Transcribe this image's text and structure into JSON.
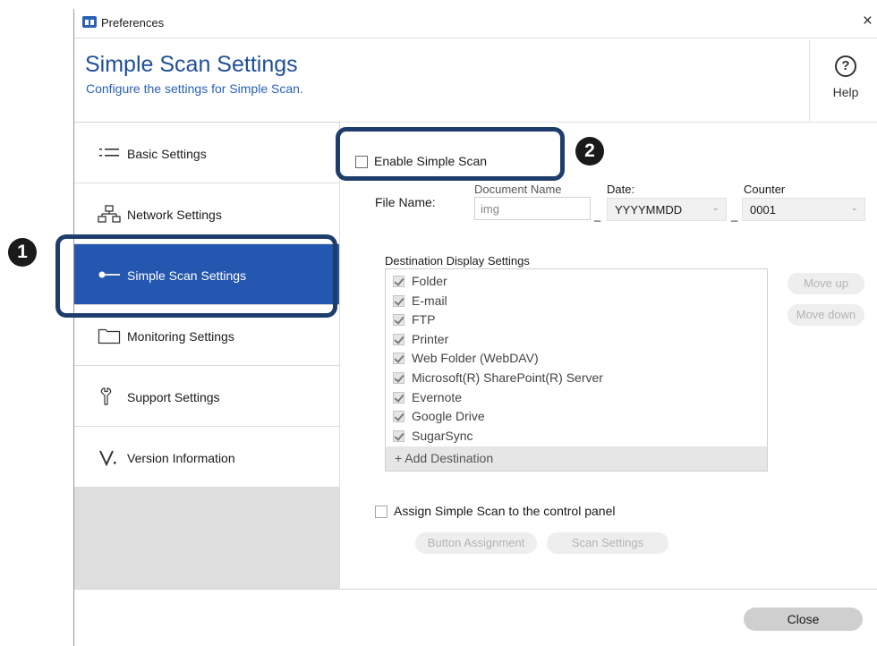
{
  "window": {
    "title": "Preferences",
    "close_glyph": "×"
  },
  "header": {
    "title": "Simple Scan Settings",
    "subtitle": "Configure the settings for Simple Scan.",
    "help_glyph": "?",
    "help_label": "Help"
  },
  "sidebar": {
    "items": [
      {
        "label": "Basic Settings",
        "icon": "list-icon",
        "selected": false
      },
      {
        "label": "Network Settings",
        "icon": "network-icon",
        "selected": false
      },
      {
        "label": "Simple Scan Settings",
        "icon": "simple-scan-icon",
        "selected": true
      },
      {
        "label": "Monitoring Settings",
        "icon": "folder-icon",
        "selected": false
      },
      {
        "label": "Support Settings",
        "icon": "wrench-icon",
        "selected": false
      },
      {
        "label": "Version Information",
        "icon": "version-icon",
        "selected": false
      }
    ]
  },
  "main": {
    "enable_simple_scan": {
      "label": "Enable Simple Scan",
      "checked": false
    },
    "file_name": {
      "label": "File Name:",
      "document_name_label": "Document Name",
      "document_name_value": "img",
      "separator": "_",
      "date_label": "Date:",
      "date_value": "YYYYMMDD",
      "counter_label": "Counter",
      "counter_value": "0001"
    },
    "destination": {
      "heading": "Destination Display Settings",
      "items": [
        {
          "label": "Folder",
          "checked": true
        },
        {
          "label": "E-mail",
          "checked": true
        },
        {
          "label": "FTP",
          "checked": true
        },
        {
          "label": "Printer",
          "checked": true
        },
        {
          "label": "Web Folder (WebDAV)",
          "checked": true
        },
        {
          "label": "Microsoft(R) SharePoint(R) Server",
          "checked": true
        },
        {
          "label": "Evernote",
          "checked": true
        },
        {
          "label": "Google Drive",
          "checked": true
        },
        {
          "label": "SugarSync",
          "checked": true
        }
      ],
      "add_label": "+ Add Destination",
      "move_up_label": "Move up",
      "move_down_label": "Move down"
    },
    "assign": {
      "label": "Assign Simple Scan to the control panel",
      "checked": false,
      "button_assignment_label": "Button Assignment",
      "scan_settings_label": "Scan Settings"
    }
  },
  "footer": {
    "close_label": "Close"
  },
  "callouts": {
    "badge_1": "1",
    "badge_2": "2"
  },
  "colors": {
    "accent": "#2457b0",
    "title_blue": "#1f4f96",
    "callout_border": "#1f3d6b"
  }
}
